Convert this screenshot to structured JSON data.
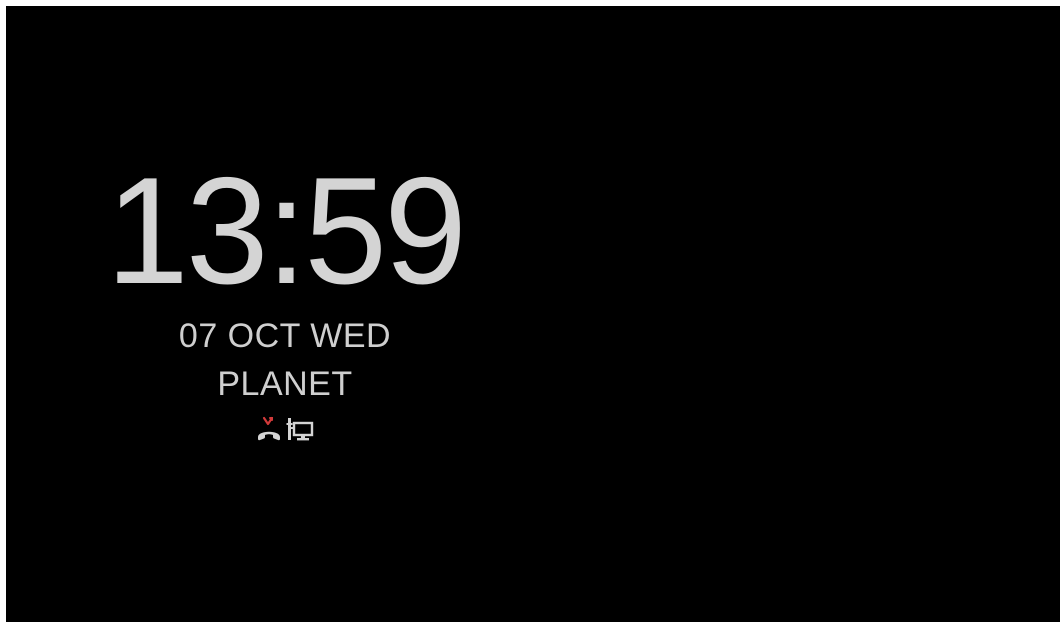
{
  "lockscreen": {
    "time": "13:59",
    "date": "07 OCT WED",
    "carrier": "PLANET",
    "status_icons": [
      {
        "name": "missed-call-icon",
        "color": "#d23a3a"
      },
      {
        "name": "usb-debugging-icon",
        "color": "#d4d4d4"
      }
    ]
  },
  "colors": {
    "background": "#000000",
    "text": "#d4d4d4",
    "missed_call_accent": "#d23a3a"
  }
}
